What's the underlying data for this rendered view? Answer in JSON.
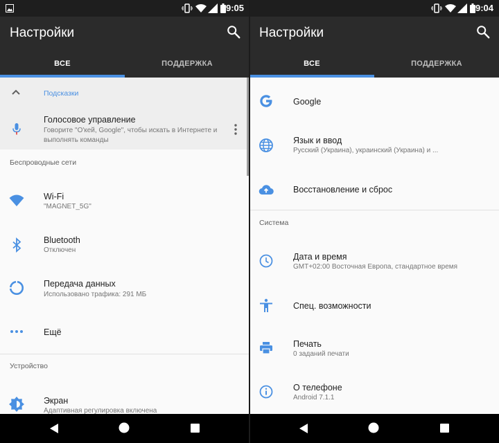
{
  "left": {
    "status_time": "9:05",
    "title": "Настройки",
    "tabs": [
      {
        "label": "ВСЕ"
      },
      {
        "label": "ПОДДЕРЖКА"
      }
    ],
    "suggestions_header": "Подсказки",
    "suggestion": {
      "title": "Голосовое управление",
      "subtitle": "Говорите \"О'кей, Google\", чтобы искать в Интернете и выполнять команды"
    },
    "wireless_header": "Беспроводные сети",
    "items": [
      {
        "title": "Wi-Fi",
        "subtitle": "\"MAGNET_5G\""
      },
      {
        "title": "Bluetooth",
        "subtitle": "Отключен"
      },
      {
        "title": "Передача данных",
        "subtitle": "Использовано трафика: 291 МБ"
      },
      {
        "title": "Ещё"
      }
    ],
    "device_header": "Устройство",
    "screen_item": {
      "title": "Экран",
      "subtitle": "Адаптивная регулировка включена"
    }
  },
  "right": {
    "status_time": "9:04",
    "title": "Настройки",
    "tabs": [
      {
        "label": "ВСЕ"
      },
      {
        "label": "ПОДДЕРЖКА"
      }
    ],
    "personal_items": [
      {
        "title": "Google"
      },
      {
        "title": "Язык и ввод",
        "subtitle": "Русский (Украина), украинский (Украина) и ..."
      },
      {
        "title": "Восстановление и сброс"
      }
    ],
    "system_header": "Система",
    "system_items": [
      {
        "title": "Дата и время",
        "subtitle": "GMT+02:00 Восточная Европа, стандартное время"
      },
      {
        "title": "Спец. возможности"
      },
      {
        "title": "Печать",
        "subtitle": "0 заданий печати"
      },
      {
        "title": "О телефоне",
        "subtitle": "Android 7.1.1"
      }
    ]
  },
  "colors": {
    "accent": "#4a90e2",
    "appbar": "#2b2b2b",
    "statusbar": "#1e1e1e"
  }
}
